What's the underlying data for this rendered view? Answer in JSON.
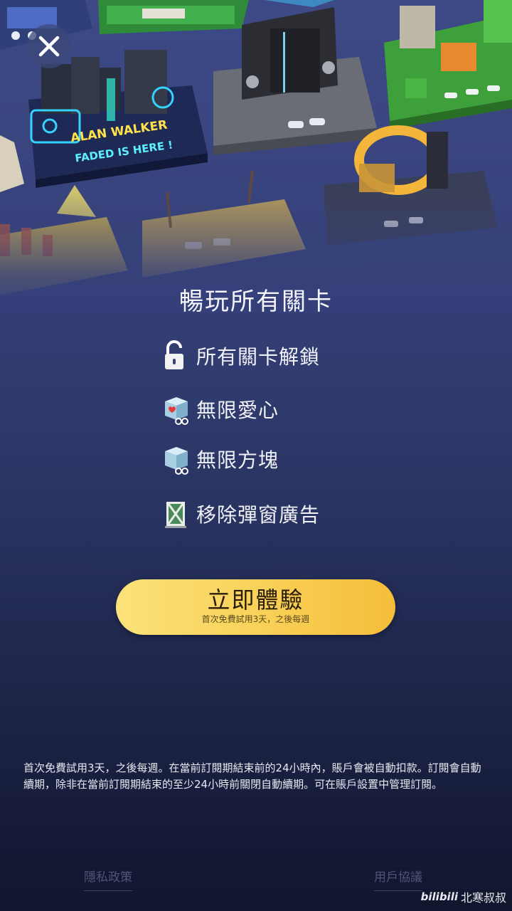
{
  "levels": {
    "alan_walker_sign": {
      "line1": "ALAN WALKER",
      "line2": "FADED IS HERE !"
    }
  },
  "close": {
    "icon": "close-icon"
  },
  "offer": {
    "title": "暢玩所有關卡",
    "features": [
      {
        "icon": "unlock-icon",
        "label": "所有關卡解鎖"
      },
      {
        "icon": "heart-cube-icon",
        "label": "無限愛心"
      },
      {
        "icon": "cube-icon",
        "label": "無限方塊"
      },
      {
        "icon": "no-ads-icon",
        "label": "移除彈窗廣告"
      }
    ],
    "cta": {
      "label": "立即體驗",
      "sub": "首次免費試用3天，之後每週"
    }
  },
  "legal": {
    "text": "首次免費試用3天，之後每週。在當前訂閱期結束前的24小時內，賬戶會被自動扣款。訂閱會自動續期，除非在當前訂閱期結束的至少24小時前關閉自動續期。可在賬戶設置中管理訂閱。"
  },
  "footer": {
    "privacy": "隱私政策",
    "terms": "用戶協議"
  },
  "watermark": {
    "logo": "bilibili",
    "text": "北寒叔叔"
  },
  "colors": {
    "cta_start": "#fbe27a",
    "cta_end": "#f5bd3a",
    "bg_top": "#3e4a86",
    "bg_bottom": "#11162e"
  }
}
